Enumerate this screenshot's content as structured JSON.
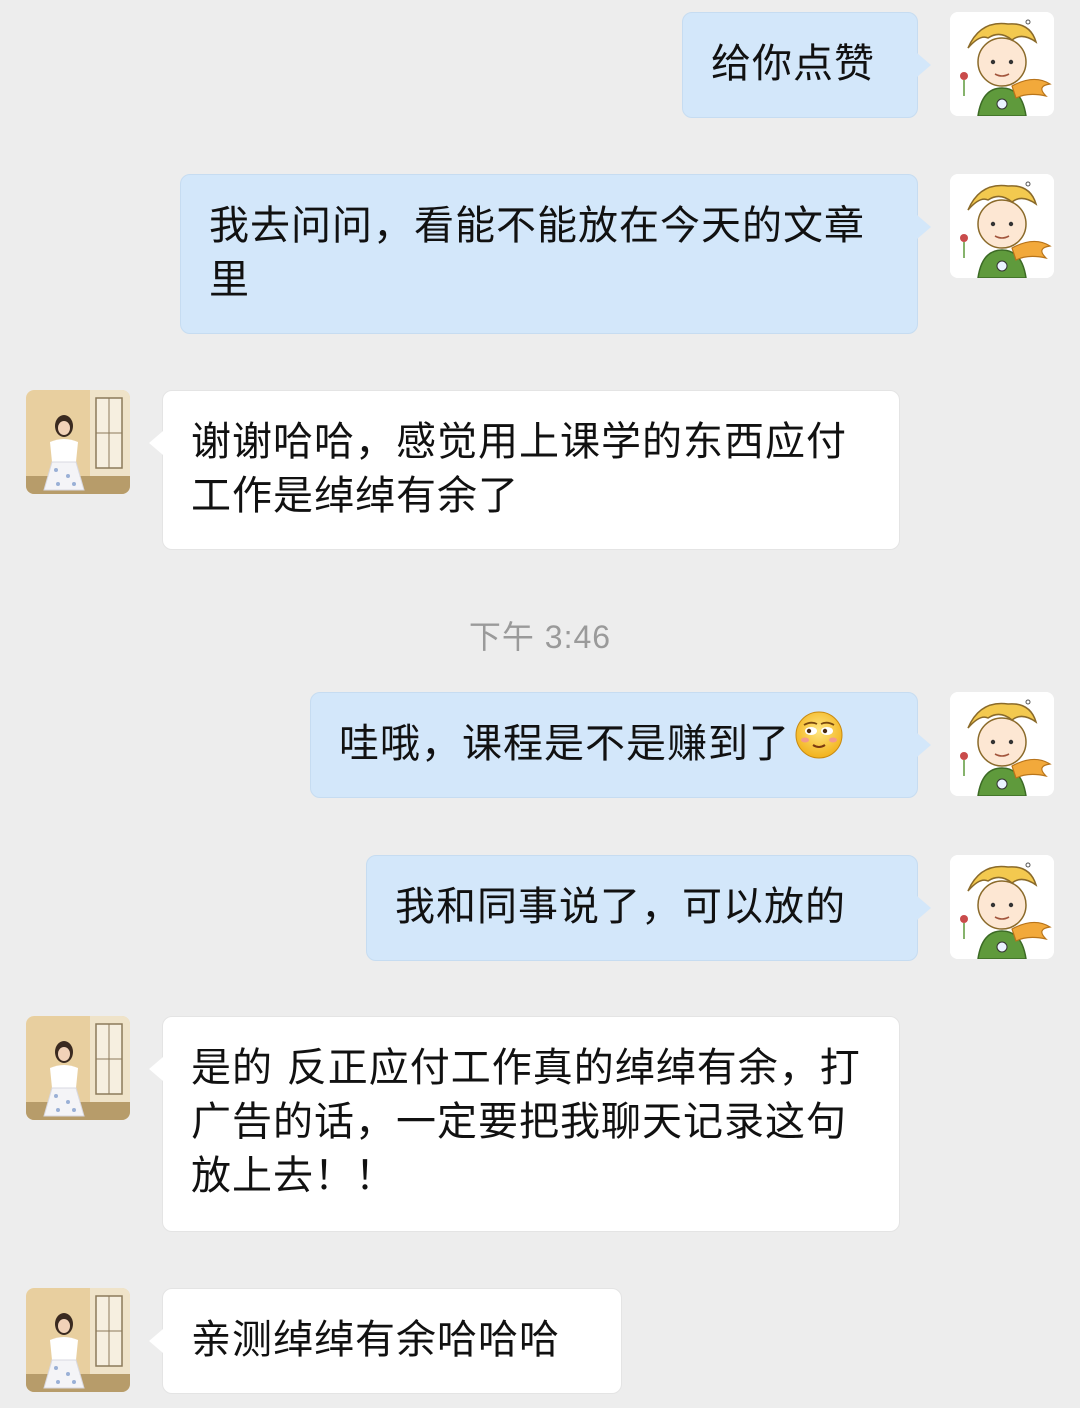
{
  "messages": [
    {
      "side": "self",
      "text": "给你点赞"
    },
    {
      "side": "self",
      "text": "我去问问，看能不能放在今天的文章里"
    },
    {
      "side": "other",
      "text": "谢谢哈哈，感觉用上课学的东西应付工作是绰绰有余了"
    },
    {
      "side": "self",
      "text": "哇哦，课程是不是赚到了",
      "emoji": "smirk-face-emoji"
    },
    {
      "side": "self",
      "text": "我和同事说了，可以放的"
    },
    {
      "side": "other",
      "text": "是的 反正应付工作真的绰绰有余，打广告的话，一定要把我聊天记录这句放上去！！"
    },
    {
      "side": "other",
      "text": "亲测绰绰有余哈哈哈"
    }
  ],
  "timestamp": "下午 3:46",
  "colors": {
    "background": "#ededed",
    "self_bubble": "#d3e7fa",
    "other_bubble": "#ffffff",
    "timestamp_text": "#9a9a9a"
  },
  "avatars": {
    "self": "cartoon-prince-avatar",
    "other": "girl-photo-avatar"
  }
}
